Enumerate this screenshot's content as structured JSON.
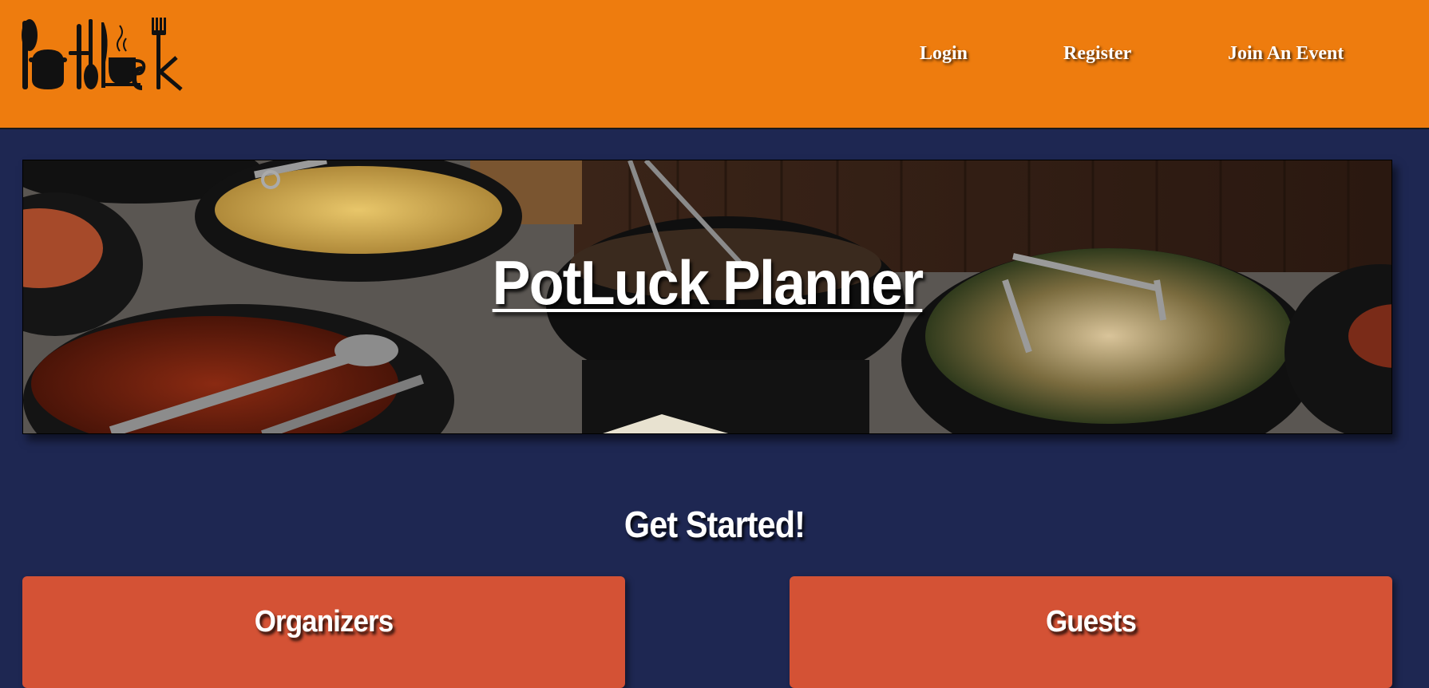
{
  "header": {
    "logo_text": "PotLuck",
    "logo_icon": "utensils-logo",
    "background_color": "#ee7c0e",
    "nav": {
      "login": "Login",
      "register": "Register",
      "join": "Join An Event"
    }
  },
  "hero": {
    "title": "PotLuck Planner",
    "image_subject": "food-buffet-image"
  },
  "get_started": {
    "title": "Get Started!"
  },
  "cards": {
    "organizers": "Organizers",
    "guests": "Guests",
    "card_color": "#d45235"
  },
  "page": {
    "background_color": "#1e2752"
  }
}
